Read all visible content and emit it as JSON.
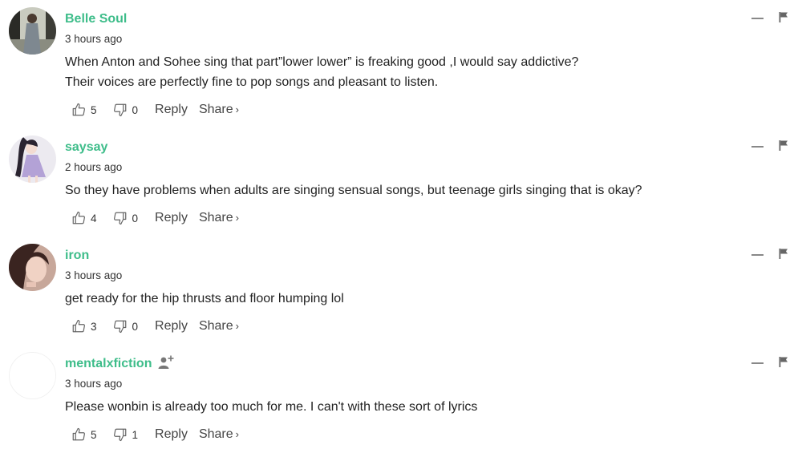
{
  "comments": [
    {
      "username": "Belle Soul",
      "time": "3 hours ago",
      "lines": [
        "When Anton and Sohee sing that part”lower lower” is freaking good ,I would say addictive?",
        "Their voices are perfectly fine to pop songs and pleasant to listen."
      ],
      "likes": "5",
      "dislikes": "0",
      "reply_label": "Reply",
      "share_label": "Share",
      "share_chevron": "›"
    },
    {
      "username": "saysay",
      "time": "2 hours ago",
      "lines": [
        "So they have problems when adults are singing sensual songs, but teenage girls singing that is okay?"
      ],
      "likes": "4",
      "dislikes": "0",
      "reply_label": "Reply",
      "share_label": "Share",
      "share_chevron": "›"
    },
    {
      "username": "iron",
      "time": "3 hours ago",
      "lines": [
        "get ready for the hip thrusts and floor humping lol"
      ],
      "likes": "3",
      "dislikes": "0",
      "reply_label": "Reply",
      "share_label": "Share",
      "share_chevron": "›"
    },
    {
      "username": "mentalxfiction",
      "time": "3 hours ago",
      "lines": [
        "Please wonbin is already too much for me. I can't with these sort of lyrics"
      ],
      "likes": "5",
      "dislikes": "1",
      "reply_label": "Reply",
      "share_label": "Share",
      "share_chevron": "›"
    }
  ],
  "colors": {
    "username": "#3ebd8a",
    "icon": "#777777"
  }
}
